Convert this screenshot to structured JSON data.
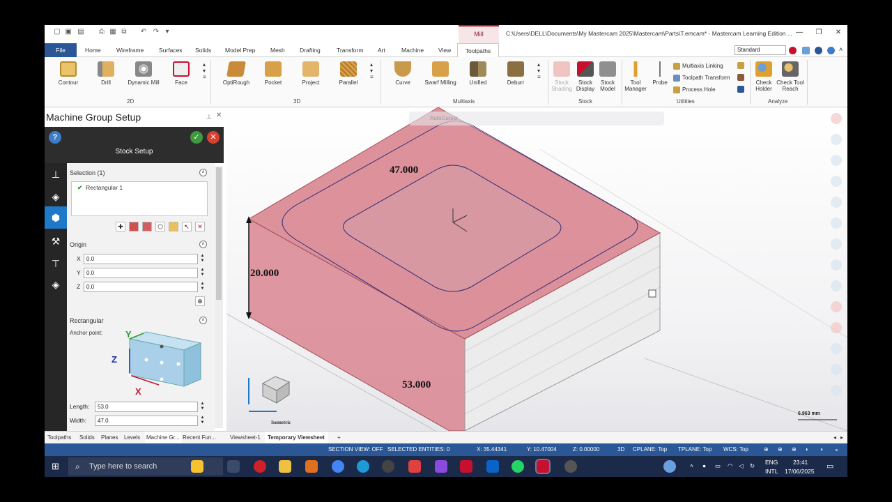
{
  "titlebar": {
    "context_tab": "Mill",
    "window_title": "C:\\Users\\DELL\\Documents\\My Mastercam 2025\\Mastercam\\Parts\\T.emcam* - Mastercam Learning Edition ..."
  },
  "tabs": [
    "File",
    "Home",
    "Wireframe",
    "Surfaces",
    "Solids",
    "Model Prep",
    "Mesh",
    "Drafting",
    "Transform",
    "Art",
    "Machine",
    "View",
    "Toolpaths"
  ],
  "ribbon": {
    "style_select": "Standard",
    "groups": {
      "g2d": "2D",
      "g3d": "3D",
      "multiaxis": "Multiaxis",
      "stock": "Stock",
      "utilities": "Utilities",
      "analyze": "Analyze"
    },
    "buttons_2d": [
      "Contour",
      "Drill",
      "Dynamic Mill",
      "Face"
    ],
    "buttons_3d": [
      "OptiRough",
      "Pocket",
      "Project",
      "Parallel"
    ],
    "buttons_multiaxis": [
      "Curve",
      "Swarf Milling",
      "Unified",
      "Deburr"
    ],
    "stock": {
      "shading": "Stock Shading",
      "display": "Stock Display",
      "model": "Stock Model"
    },
    "utilities": {
      "tool_manager": "Tool Manager",
      "probe": "Probe",
      "multiaxis_linking": "Multiaxis Linking",
      "toolpath_transform": "Toolpath Transform",
      "process_hole": "Process Hole"
    },
    "analyze": {
      "check_holder": "Check Holder",
      "check_tool_reach": "Check Tool Reach"
    }
  },
  "panel": {
    "title": "Machine Group Setup",
    "subtitle": "Stock Setup",
    "selection": {
      "header": "Selection (1)",
      "item": "Rectangular 1"
    },
    "origin": {
      "header": "Origin",
      "x_label": "X",
      "x": "0.0",
      "y_label": "Y",
      "y": "0.0",
      "z_label": "Z",
      "z": "0.0"
    },
    "rectangular": {
      "header": "Rectangular",
      "anchor_label": "Anchor point:",
      "length_label": "Length:",
      "length": "53.0",
      "width_label": "Width:",
      "width": "47.0"
    }
  },
  "viewport": {
    "autocursor": "AutoCursor",
    "dim_top": "47.000",
    "dim_height": "20.000",
    "dim_bottom": "53.000",
    "scale": "6.963 mm",
    "view_name": "Isometric",
    "stock_color": "#d98590"
  },
  "bottom_tabs": [
    "Toolpaths",
    "Solids",
    "Planes",
    "Levels",
    "Machine Gr...",
    "Recent Fun...",
    "Viewsheet-1",
    "Temporary Viewsheet",
    "+"
  ],
  "status": {
    "section_view": "SECTION VIEW: OFF",
    "selected": "SELECTED ENTITIES: 0",
    "x": "X:   35.44341",
    "y": "Y:   10.47004",
    "z": "Z:   0.00000",
    "mode": "3D",
    "cplane": "CPLANE: Top",
    "tplane": "TPLANE: Top",
    "wcs": "WCS: Top"
  },
  "taskbar": {
    "search_placeholder": "Type here to search",
    "lang1": "ENG",
    "lang2": "INTL",
    "time": "23:41",
    "date": "17/06/2025"
  }
}
